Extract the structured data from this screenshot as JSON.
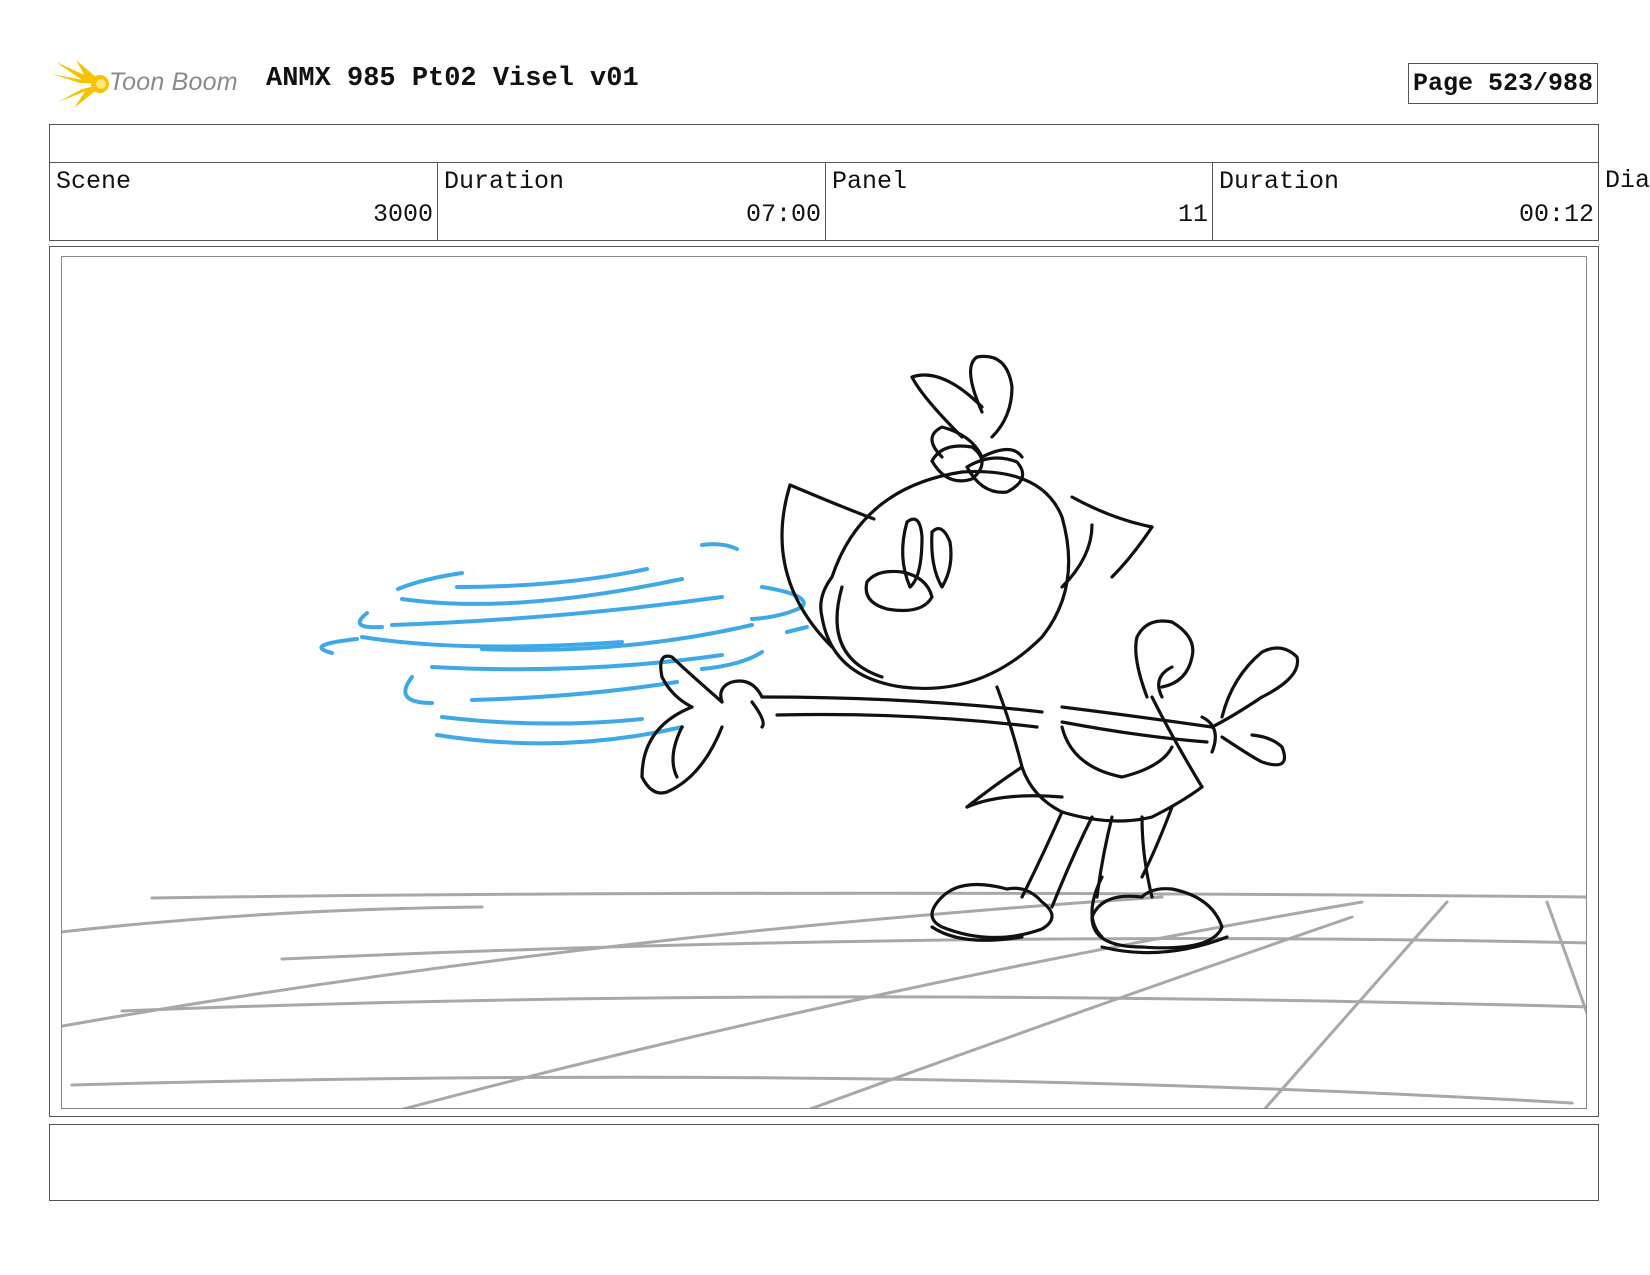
{
  "header": {
    "logo_text": "Toon Boom",
    "title": "ANMX 985 Pt02 Visel v01",
    "page": "Page 523/988"
  },
  "info": {
    "scene_label": "Scene",
    "scene_value": "3000",
    "duration_label": "Duration",
    "duration_value": "07:00",
    "panel_label": "Panel",
    "panel_value": "11",
    "panel_duration_label": "Duration",
    "panel_duration_value": "00:12",
    "dialog_label": "Dia"
  },
  "colors": {
    "swirl": "#3fa9e8",
    "ink": "#111111",
    "floor": "#a8a8a8",
    "logo": "#f5c400"
  }
}
